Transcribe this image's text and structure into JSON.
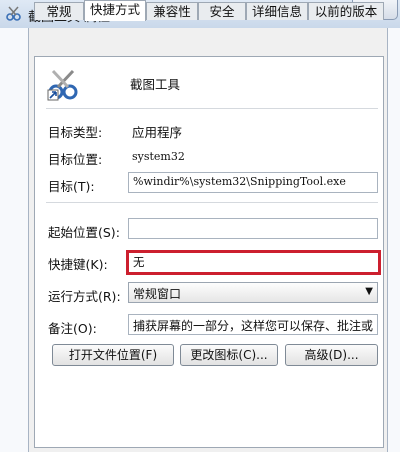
{
  "window": {
    "title": "截图工具 属性",
    "close_glyph": "✕"
  },
  "tabs": [
    {
      "label": "常规"
    },
    {
      "label": "快捷方式"
    },
    {
      "label": "兼容性"
    },
    {
      "label": "安全"
    },
    {
      "label": "详细信息"
    },
    {
      "label": "以前的版本"
    }
  ],
  "shortcut": {
    "name": "截图工具",
    "icon": "scissors-icon",
    "target_type_label": "目标类型:",
    "target_type_value": "应用程序",
    "target_location_label": "目标位置:",
    "target_location_value": "system32",
    "target_label": "目标(T):",
    "target_value": "%windir%\\system32\\SnippingTool.exe",
    "start_in_label": "起始位置(S):",
    "start_in_value": "",
    "hotkey_label": "快捷键(K):",
    "hotkey_value": "无",
    "run_label": "运行方式(R):",
    "run_value": "常规窗口",
    "comment_label": "备注(O):",
    "comment_value": "捕获屏幕的一部分，这样您可以保存、批注或",
    "buttons": {
      "open_location": "打开文件位置(F)",
      "change_icon": "更改图标(C)...",
      "advanced": "高级(D)..."
    }
  },
  "colors": {
    "highlight": "#cc1f2e"
  }
}
